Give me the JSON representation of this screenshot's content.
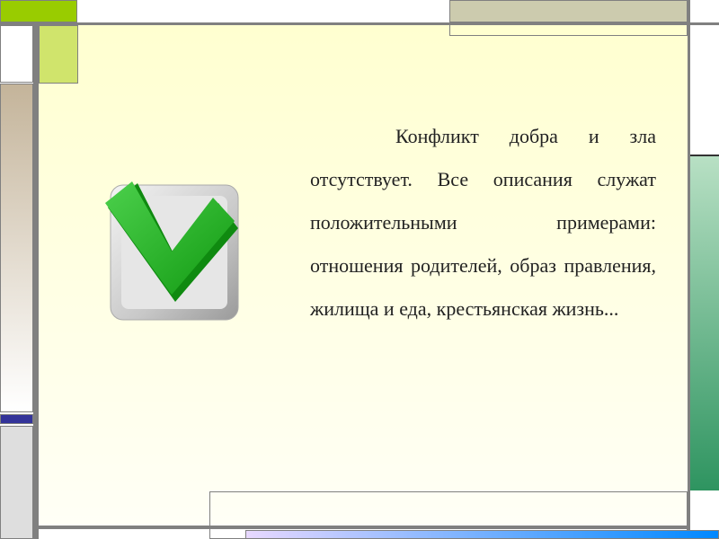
{
  "slide": {
    "paragraph": "Конфликт добра и зла отсутствует. Все описания служат положительными примерами: отношения родителей, образ правления, жилища и еда, крестьянская жизнь...",
    "image_icon": "green-checkmark-icon"
  },
  "colors": {
    "accent_green": "#99cc00",
    "light_green": "#d0e46c",
    "tan": "#c4b49a",
    "blue": "#333399",
    "teal_green": "#3a9c6a",
    "frame_gray": "#808080",
    "background": "#ffffd0"
  }
}
